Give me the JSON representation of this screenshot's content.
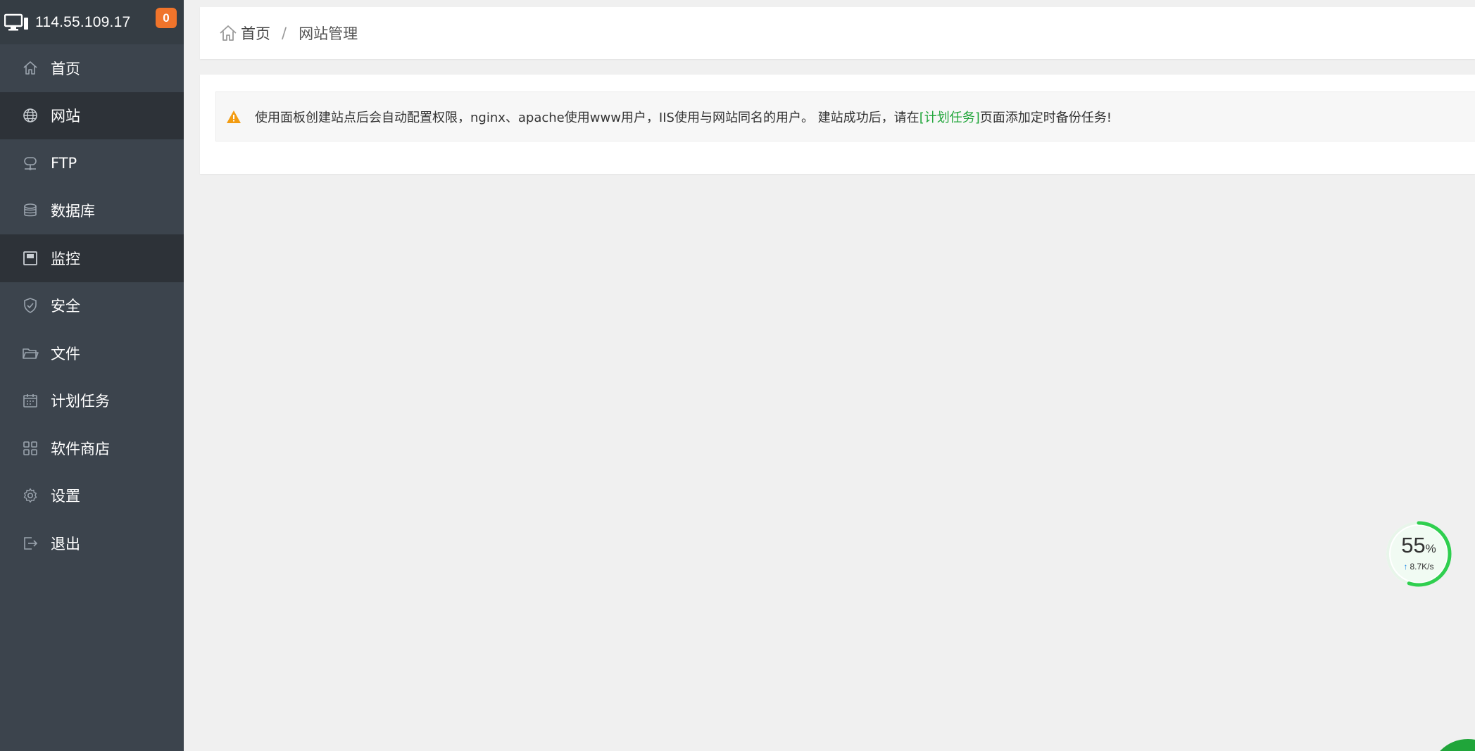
{
  "header": {
    "ip": "114.55.109.17",
    "badge_count": "0",
    "icon": "monitor-icon"
  },
  "sidebar": {
    "items": [
      {
        "label": "首页",
        "icon": "home-icon",
        "active": false
      },
      {
        "label": "网站",
        "icon": "globe-icon",
        "active": true
      },
      {
        "label": "FTP",
        "icon": "ftp-icon",
        "active": false
      },
      {
        "label": "数据库",
        "icon": "database-icon",
        "active": false
      },
      {
        "label": "监控",
        "icon": "monitor-panel-icon",
        "active": true
      },
      {
        "label": "安全",
        "icon": "shield-icon",
        "active": false
      },
      {
        "label": "文件",
        "icon": "folder-icon",
        "active": false
      },
      {
        "label": "计划任务",
        "icon": "calendar-icon",
        "active": false
      },
      {
        "label": "软件商店",
        "icon": "grid-icon",
        "active": false
      },
      {
        "label": "设置",
        "icon": "gear-icon",
        "active": false
      },
      {
        "label": "退出",
        "icon": "logout-icon",
        "active": false
      }
    ]
  },
  "breadcrumb": {
    "home": "首页",
    "separator": "/",
    "current": "网站管理"
  },
  "notice": {
    "text_before": "使用面板创建站点后会自动配置权限，nginx、apache使用www用户，IIS使用与网站同名的用户。 建站成功后，请在",
    "link": "[计划任务]",
    "text_after": "页面添加定时备份任务!"
  },
  "speed_widget": {
    "percent": "55",
    "percent_unit": "%",
    "rate": "8.7K/s",
    "progress_fraction": 0.55
  },
  "colors": {
    "sidebar_bg": "#3c444d",
    "sidebar_active": "#2d3238",
    "badge": "#f0742b",
    "accent_green": "#20a53a",
    "warning_orange": "#f39c12"
  }
}
